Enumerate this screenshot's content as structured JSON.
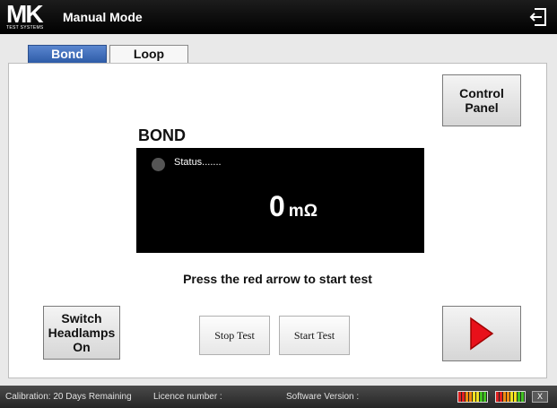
{
  "header": {
    "logo_text": "MK",
    "logo_subtext": "TEST SYSTEMS",
    "title": "Manual Mode"
  },
  "tabs": [
    {
      "label": "Bond",
      "active": true
    },
    {
      "label": "Loop",
      "active": false
    }
  ],
  "controls": {
    "control_panel_label": "Control\nPanel",
    "headlamps_label": "Switch\nHeadlamps\nOn",
    "stop_label": "Stop Test",
    "start_label": "Start Test"
  },
  "bond": {
    "heading": "BOND",
    "status": "Status.......",
    "reading_value": "0",
    "reading_unit": "mΩ",
    "prompt": "Press the red arrow to start test"
  },
  "statusbar": {
    "calibration": "Calibration: 20 Days Remaining",
    "licence": "Licence number :",
    "software": "Software Version :",
    "close_label": "X"
  },
  "colors": {
    "tab_active": "#3a6bbd",
    "arrow_red": "#e8101a",
    "meter_colors": [
      "#e02020",
      "#f08a10",
      "#f0e020",
      "#40c020"
    ]
  },
  "icons": [
    "exit-icon",
    "play-arrow-icon"
  ]
}
